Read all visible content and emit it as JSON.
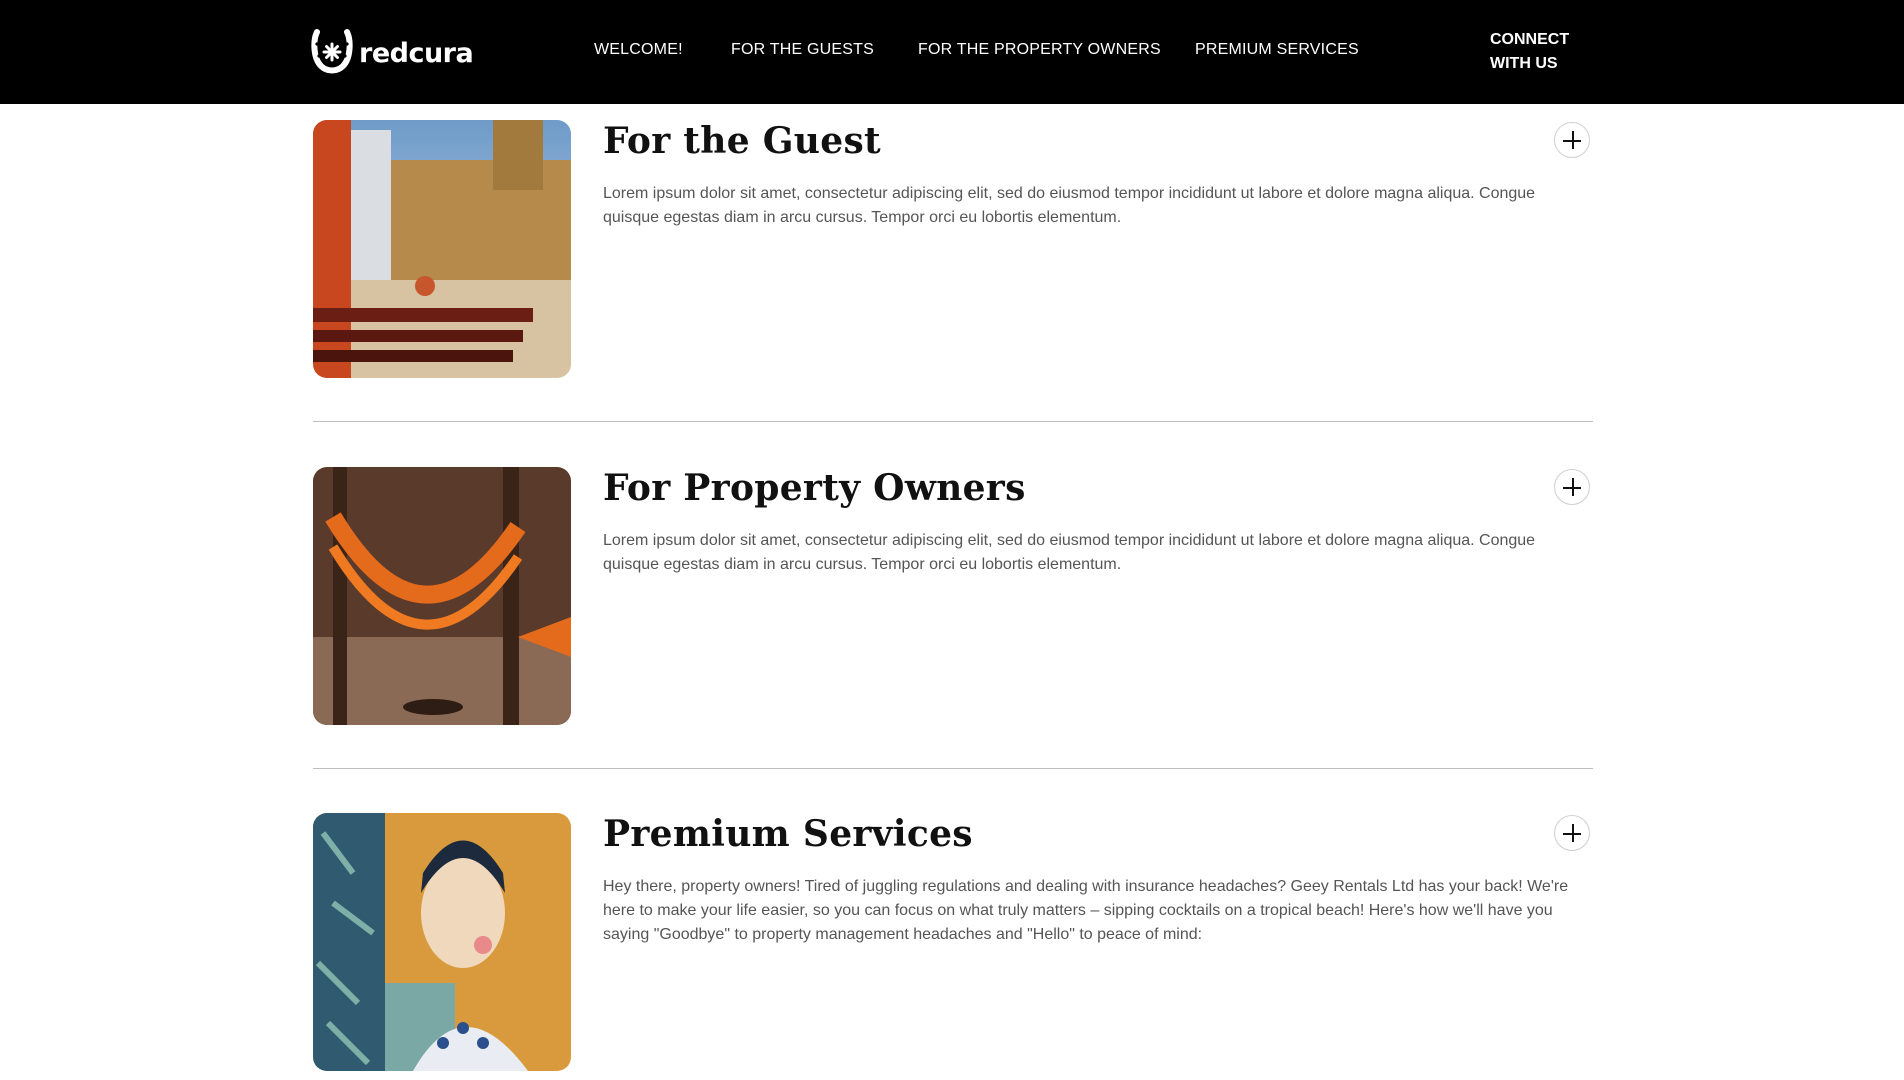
{
  "header": {
    "brand": "redcura",
    "nav": [
      {
        "label": "WELCOME!"
      },
      {
        "label": "FOR THE GUESTS"
      },
      {
        "label": "FOR THE PROPERTY OWNERS"
      },
      {
        "label": "PREMIUM SERVICES"
      }
    ],
    "connect_line1": "CONNECT",
    "connect_line2": "WITH US"
  },
  "sections": [
    {
      "title": "For the Guest",
      "body": "Lorem ipsum dolor sit amet, consectetur adipiscing elit, sed do eiusmod tempor incididunt ut labore et dolore magna aliqua. Congue quisque egestas diam in arcu cursus. Tempor orci eu lobortis elementum."
    },
    {
      "title": "For Property Owners",
      "body": "Lorem ipsum dolor sit amet, consectetur adipiscing elit, sed do eiusmod tempor incididunt ut labore et dolore magna aliqua. Congue quisque egestas diam in arcu cursus. Tempor orci eu lobortis elementum."
    },
    {
      "title": "Premium Services",
      "body": "Hey there, property owners! Tired of juggling regulations and dealing with insurance headaches? Geey Rentals Ltd has your back! We're here to make your life easier, so you can focus on what truly matters – sipping cocktails on a tropical beach! Here's how we'll have you saying \"Goodbye\" to property management headaches and \"Hello\" to peace of mind:"
    }
  ],
  "colors": {
    "header_bg": "#000000",
    "page_bg": "#ffffff",
    "body_text": "#555555",
    "divider": "#bdbdbd"
  },
  "icons": {
    "logo": "horseshoe-logo-icon",
    "expand": "plus-icon"
  }
}
